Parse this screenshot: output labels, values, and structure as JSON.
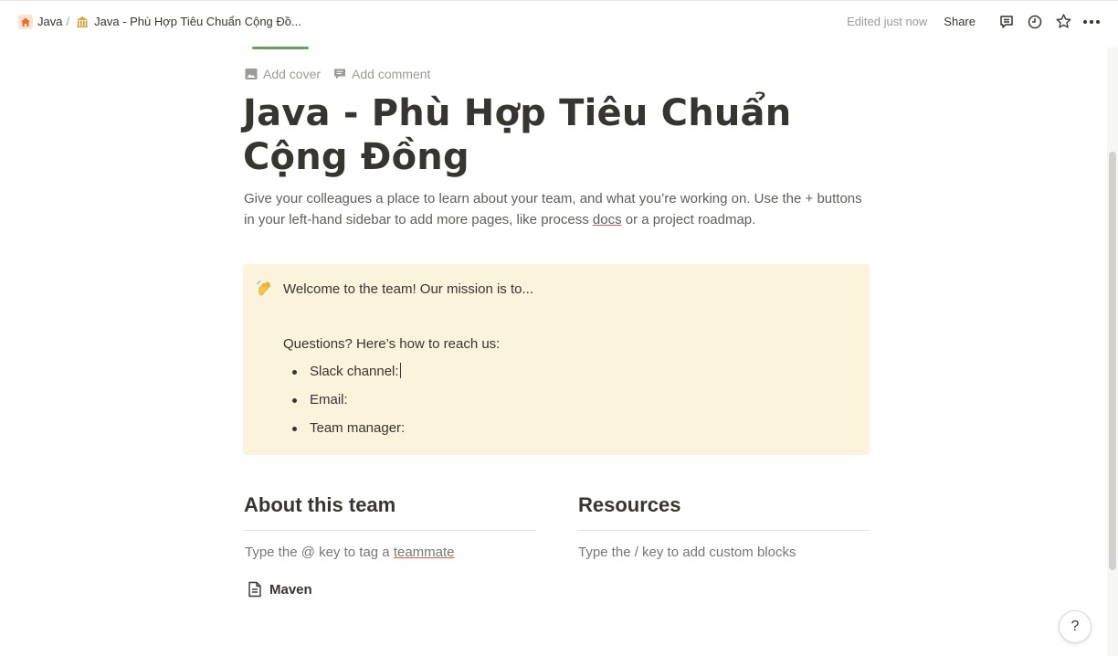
{
  "breadcrumb": {
    "items": [
      {
        "label": "Java"
      },
      {
        "label": "Java - Phù Hợp Tiêu Chuẩn Cộng Đồ..."
      }
    ],
    "separator": "/"
  },
  "topbar": {
    "edited": "Edited just now",
    "share": "Share"
  },
  "page_actions": {
    "add_cover": "Add cover",
    "add_comment": "Add comment"
  },
  "page": {
    "title": "Java - Phù Hợp Tiêu Chuẩn Cộng Đồng",
    "description_part1": "Give your colleagues a place to learn about your team, and what you’re working on. Use the + buttons in your left-hand sidebar to add more pages, like process ",
    "description_link": "docs",
    "description_part2": " or a project roadmap."
  },
  "callout": {
    "line1": "Welcome to the team! Our mission is to...",
    "line2": "Questions? Here’s how to reach us:",
    "bullets": [
      "Slack channel:",
      "Email:",
      "Team manager:"
    ]
  },
  "about": {
    "heading": "About this team",
    "hint_part1": "Type the @ key to tag a ",
    "hint_link": "teammate",
    "page_link": "Maven"
  },
  "resources": {
    "heading": "Resources",
    "hint": "Type the / key to add custom blocks"
  },
  "help": {
    "label": "?"
  },
  "colors": {
    "callout_bg": "#fbf3db",
    "text": "#37352f",
    "muted": "#9b9a97",
    "accent_green": "#6aa05d"
  }
}
